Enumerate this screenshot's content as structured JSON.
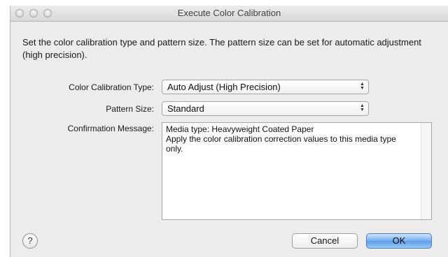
{
  "window": {
    "title": "Execute Color Calibration"
  },
  "description": "Set the color calibration type and pattern size. The pattern size can be set for automatic adjustment (high precision).",
  "form": {
    "calibration_type": {
      "label": "Color Calibration Type:",
      "value": "Auto Adjust (High Precision)"
    },
    "pattern_size": {
      "label": "Pattern Size:",
      "value": "Standard"
    },
    "confirmation": {
      "label": "Confirmation Message:",
      "text": "Media type: Heavyweight Coated Paper\nApply the color calibration correction values to this media type only."
    }
  },
  "buttons": {
    "help": "?",
    "cancel": "Cancel",
    "ok": "OK"
  },
  "icons": {
    "select_arrows": "up-down-chevron-icon"
  },
  "colors": {
    "default_button": "#5c9ee9",
    "window_bg": "#ececec"
  }
}
